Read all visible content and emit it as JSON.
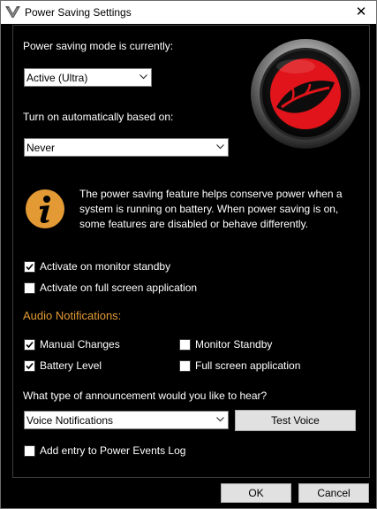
{
  "window": {
    "title": "Power Saving Settings",
    "close_glyph": "✕"
  },
  "mode": {
    "label": "Power saving mode is currently:",
    "value": "Active (Ultra)"
  },
  "auto": {
    "label": "Turn on automatically based on:",
    "value": "Never"
  },
  "info": {
    "text": "The power saving feature helps conserve power when a system is running on battery. When power saving is on, some features are disabled or behave differently.",
    "icon": "info-icon"
  },
  "activation": [
    {
      "label": "Activate on monitor standby",
      "checked": true
    },
    {
      "label": "Activate on full screen application",
      "checked": false
    }
  ],
  "audio": {
    "heading": "Audio Notifications:",
    "items": [
      {
        "label": "Manual Changes",
        "checked": true
      },
      {
        "label": "Battery Level",
        "checked": true
      },
      {
        "label": "Monitor Standby",
        "checked": false
      },
      {
        "label": "Full screen application",
        "checked": false
      }
    ]
  },
  "announcement": {
    "label": "What type of announcement would you like to hear?",
    "value": "Voice Notifications",
    "test_button": "Test Voice"
  },
  "events_log": {
    "label": "Add entry to Power Events Log",
    "checked": false
  },
  "footer": {
    "ok": "OK",
    "cancel": "Cancel"
  },
  "colors": {
    "accent": "#e49a34",
    "logo_red": "#e0141a",
    "background": "#000000"
  }
}
